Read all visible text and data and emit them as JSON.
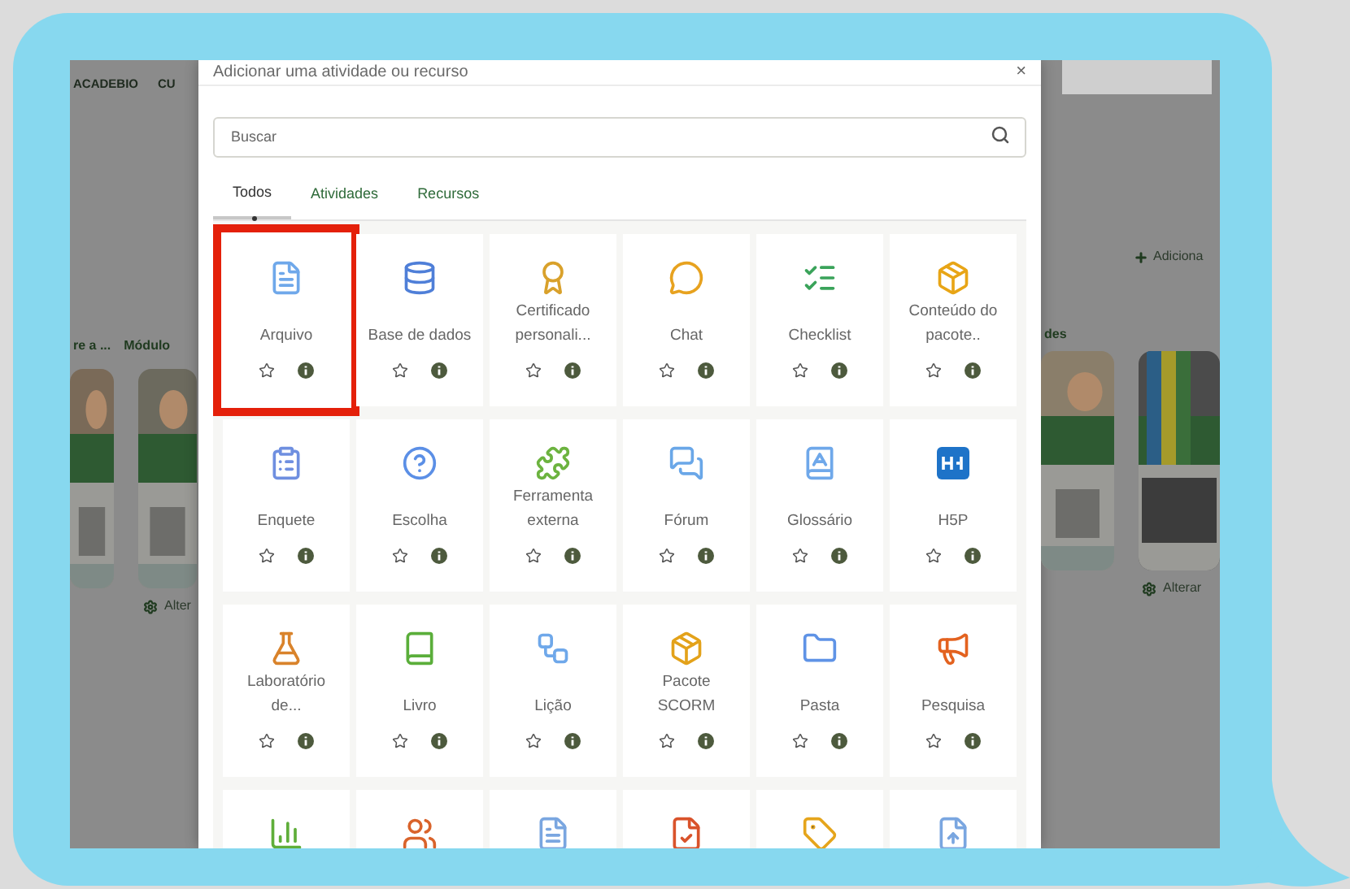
{
  "background_page": {
    "left": {
      "brand": "ACADEBIO",
      "menu_item": "CU",
      "card_titles": [
        "re a ...",
        "Módulo"
      ],
      "action": "Alter"
    },
    "right": {
      "add_link": "Adiciona",
      "card_title": "des",
      "action": "Alterar"
    }
  },
  "dialog": {
    "title": "Adicionar uma atividade ou recurso",
    "close": "×",
    "search": {
      "placeholder": "Buscar"
    },
    "tabs": [
      {
        "label": "Todos",
        "selected": true
      },
      {
        "label": "Atividades",
        "selected": false
      },
      {
        "label": "Recursos",
        "selected": false
      }
    ],
    "tiles": [
      {
        "kind": "full",
        "label": "Arquivo",
        "highlighted": true
      },
      {
        "kind": "full",
        "label": "Base de dados",
        "highlighted": false
      },
      {
        "kind": "full",
        "label": "Certificado personali...",
        "highlighted": false
      },
      {
        "kind": "full",
        "label": "Chat",
        "highlighted": false
      },
      {
        "kind": "full",
        "label": "Checklist",
        "highlighted": false
      },
      {
        "kind": "full",
        "label": "Conteúdo do pacote..",
        "highlighted": false
      },
      {
        "kind": "full",
        "label": "Enquete",
        "highlighted": false
      },
      {
        "kind": "full",
        "label": "Escolha",
        "highlighted": false
      },
      {
        "kind": "full",
        "label": "Ferramenta externa",
        "highlighted": false
      },
      {
        "kind": "full",
        "label": "Fórum",
        "highlighted": false
      },
      {
        "kind": "full",
        "label": "Glossário",
        "highlighted": false
      },
      {
        "kind": "full",
        "label": "H5P",
        "highlighted": false
      },
      {
        "kind": "full",
        "label": "Laboratório de...",
        "highlighted": false
      },
      {
        "kind": "full",
        "label": "Livro",
        "highlighted": false
      },
      {
        "kind": "full",
        "label": "Lição",
        "highlighted": false
      },
      {
        "kind": "full",
        "label": "Pacote SCORM",
        "highlighted": false
      },
      {
        "kind": "full",
        "label": "Pasta",
        "highlighted": false
      },
      {
        "kind": "full",
        "label": "Pesquisa",
        "highlighted": false
      },
      {
        "kind": "partial"
      },
      {
        "kind": "partial"
      },
      {
        "kind": "partial"
      },
      {
        "kind": "partial"
      },
      {
        "kind": "partial"
      },
      {
        "kind": "partial"
      }
    ]
  }
}
